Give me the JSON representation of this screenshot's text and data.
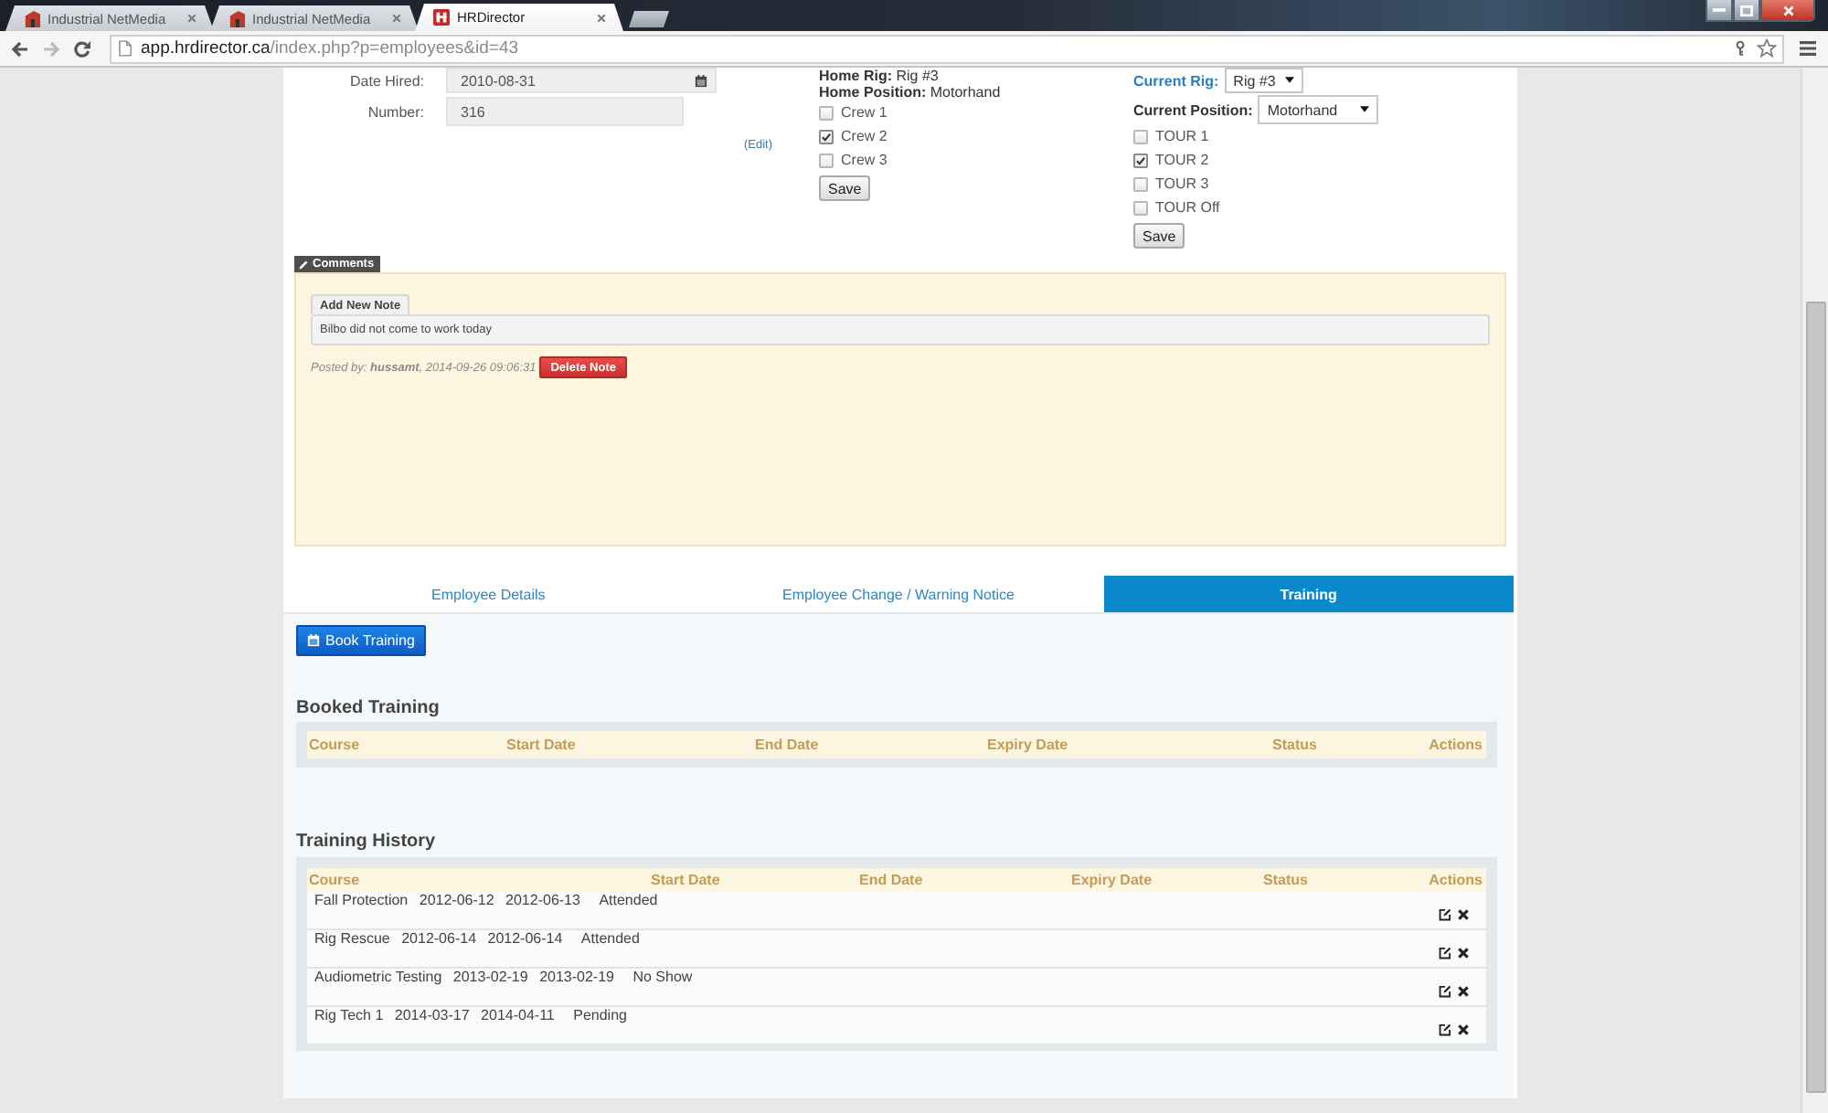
{
  "browser": {
    "tabs": [
      {
        "title": "Industrial NetMedia",
        "kind": "corner",
        "selected": false
      },
      {
        "title": "Industrial NetMedia",
        "kind": "corner",
        "selected": false
      },
      {
        "title": "HRDirector",
        "kind": "square",
        "selected": true
      }
    ],
    "address": {
      "domain": "app.hrdirector.ca",
      "path": "/index.php?p=employees&id=43"
    }
  },
  "employee_form": {
    "fields": [
      {
        "label": "Date Hired:",
        "value": "2010-08-31",
        "kind": "date"
      },
      {
        "label": "Number:",
        "value": "316",
        "kind": "text"
      }
    ],
    "edit_link": "(Edit)"
  },
  "home_assignment": {
    "rig": "**Home Rig:** Rig #3",
    "position": "**Home Position:** Motorhand",
    "crews": [
      {
        "label": "Crew 1",
        "checked": false
      },
      {
        "label": "Crew 2",
        "checked": true
      },
      {
        "label": "Crew 3",
        "checked": false
      }
    ],
    "save_button": "Save"
  },
  "current_assignment": {
    "rig_label": "Current Rig:",
    "rig": "Rig #3",
    "position_label": "Current Position:",
    "position": "Motorhand",
    "tours": [
      {
        "label": "TOUR 1",
        "checked": false
      },
      {
        "label": "TOUR 2",
        "checked": true
      },
      {
        "label": "TOUR 3",
        "checked": false
      },
      {
        "label": "TOUR Off",
        "checked": false
      }
    ],
    "save_button": "Save"
  },
  "comments": {
    "title": "Comments",
    "add_button": "Add New Note",
    "notes": [
      {
        "text": "Bilbo did not come to work today",
        "posted": "Posted by: **hussamt**, 2014-09-26 09:06:31",
        "delete_button": "Delete Note"
      }
    ]
  },
  "tabs": [
    {
      "label": "Employee Details",
      "selected": false
    },
    {
      "label": "Employee Change / Warning Notice",
      "selected": false
    },
    {
      "label": "Training",
      "selected": true
    }
  ],
  "book_button": "Book Training",
  "booked_training": {
    "title": "Booked Training",
    "columns": [
      "Course",
      "Start Date",
      "End Date",
      "Expiry Date",
      "Status",
      "Actions"
    ]
  },
  "training_history": {
    "title": "Training History",
    "columns": [
      "Course",
      "Start Date",
      "End Date",
      "Expiry Date",
      "Status",
      "Actions"
    ],
    "rows": [
      {
        "course": "Fall Protection",
        "start_date": "2012-06-12",
        "end_date": "2012-06-13",
        "status": "Attended"
      },
      {
        "course": "Rig Rescue",
        "start_date": "2012-06-14",
        "end_date": "2012-06-14",
        "status": "Attended"
      },
      {
        "course": "Audiometric Testing",
        "start_date": "2013-02-19",
        "end_date": "2013-02-19",
        "status": "No Show"
      },
      {
        "course": "Rig Tech 1",
        "start_date": "2014-03-17",
        "end_date": "2014-04-11",
        "status": "Pending"
      }
    ]
  }
}
